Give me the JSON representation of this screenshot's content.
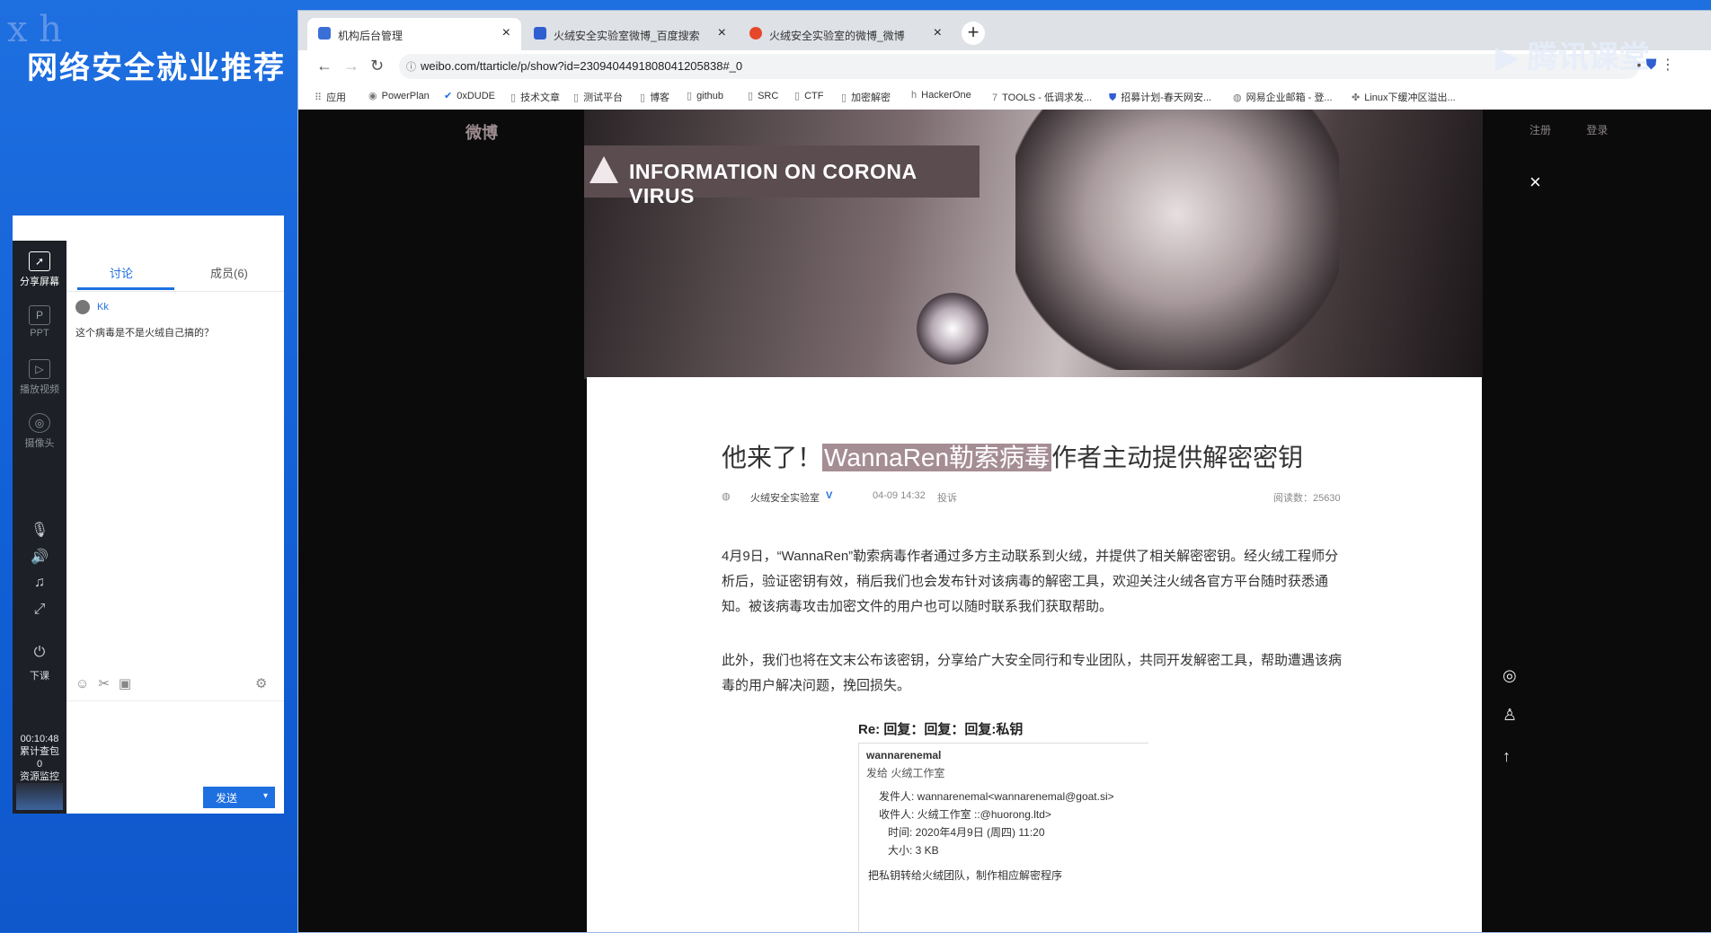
{
  "desktop": {
    "title": "网络安全就业推荐"
  },
  "classroom": {
    "topbar_icons": [
      "pin-icon",
      "share-icon",
      "popout-icon",
      "dropdown-icon",
      "stick-icon",
      "minimize-icon",
      "close-icon"
    ],
    "rail": [
      {
        "label": "分享屏幕",
        "icon": "share-screen-icon",
        "active": true
      },
      {
        "label": "PPT",
        "icon": "ppt-icon",
        "active": false
      },
      {
        "label": "播放视频",
        "icon": "video-icon",
        "active": false
      },
      {
        "label": "摄像头",
        "icon": "camera-icon",
        "active": false
      }
    ],
    "timer": "00:10:48",
    "timer_label": "累计查包",
    "timer_count": "0",
    "resource_label": "资源监控",
    "leave_label": "下课",
    "tabs": {
      "discuss": "讨论",
      "members": "成员(6)"
    },
    "message": {
      "user": "Kk",
      "text": "这个病毒是不是火绒自己搞的？"
    },
    "send": "发送"
  },
  "browser": {
    "tabs": [
      {
        "title": "机构后台管理",
        "active": true
      },
      {
        "title": "火绒安全实验室微博_百度搜索",
        "active": false
      },
      {
        "title": "火绒安全实验室的微博_微博",
        "active": false
      }
    ],
    "url": "weibo.com/ttarticle/p/show?id=2309404491808041205838#_0",
    "bookmarks": [
      "应用",
      "PowerPlan",
      "0xDUDE",
      "技术文章",
      "测试平台",
      "博客",
      "github",
      "SRC",
      "CTF",
      "加密解密",
      "HackerOne",
      "TOOLS - 低调求发...",
      "招募计划-春天网安...",
      "网易企业邮箱 - 登...",
      "Linux下缓冲区溢出..."
    ]
  },
  "weibo": {
    "logo": "微博",
    "links": [
      "注册",
      "登录"
    ],
    "banner": "INFORMATION ON CORONA VIRUS"
  },
  "article": {
    "title_pre": "他来了！",
    "title_hl": "WannaRen勒索病毒",
    "title_post": "作者主动提供解密密钥",
    "author": "火绒安全实验室",
    "date": "04-09 14:32",
    "report": "投诉",
    "reads": "阅读数：25630",
    "p1": "4月9日，“WannaRen”勒索病毒作者通过多方主动联系到火绒，并提供了相关解密密钥。经火绒工程师分析后，验证密钥有效，稍后我们也会发布针对该病毒的解密工具，欢迎关注火绒各官方平台随时获悉通知。被该病毒攻击加密文件的用户也可以随时联系我们获取帮助。",
    "p2": "此外，我们也将在文末公布该密钥，分享给广大安全同行和专业团队，共同开发解密工具，帮助遭遇该病毒的用户解决问题，挽回损失。",
    "email": {
      "subject": "Re: 回复：回复：回复:私钥",
      "sender_name": "wannarenemal",
      "sent_to": "发给 火绒工作室",
      "from": "发件人: wannarenemal<wannarenemal@goat.si>",
      "to": "收件人: 火绒工作室        ::@huorong.ltd>",
      "time": "时间: 2020年4月9日 (周四) 11:20",
      "size": "大小: 3 KB",
      "body": "把私钥转给火绒团队，制作相应解密程序"
    }
  }
}
